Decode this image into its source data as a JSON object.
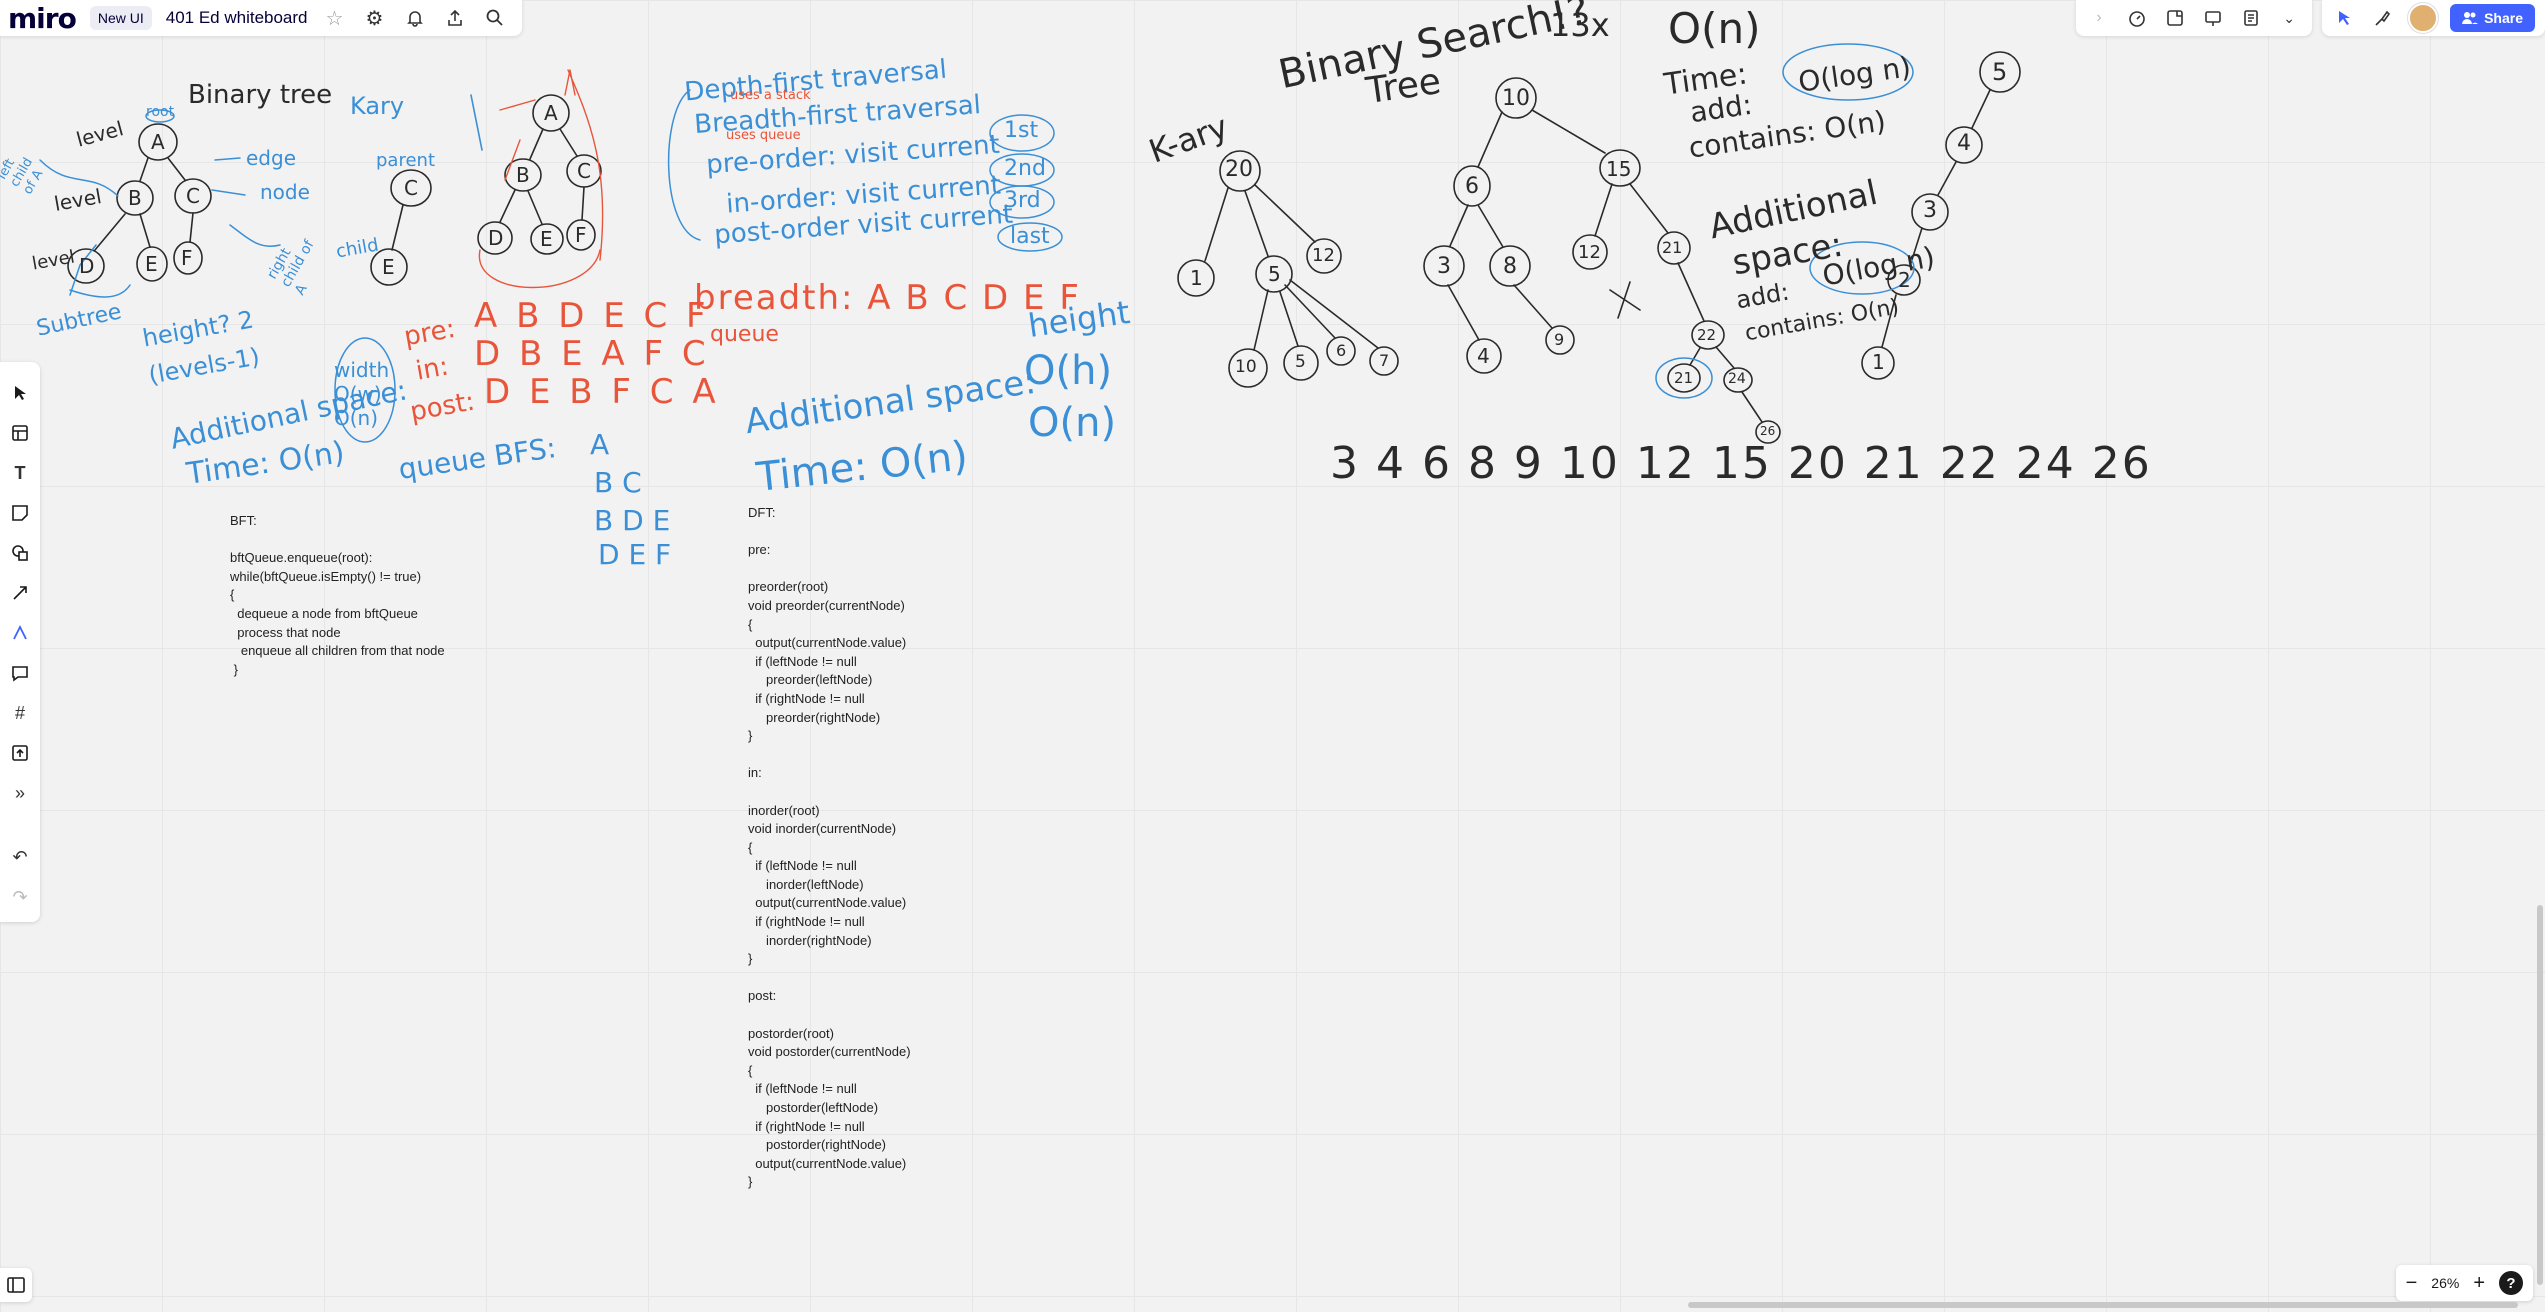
{
  "app": {
    "logo": "miro",
    "new_ui_badge": "New UI",
    "board_title": "401 Ed whiteboard",
    "share_label": "Share",
    "zoom_level": "26%",
    "help_label": "?"
  },
  "icons": {
    "star": "star-icon",
    "settings": "gear-icon",
    "notifications": "bell-icon",
    "export": "upload-icon",
    "search": "search-icon"
  },
  "colors": {
    "accent": "#4262ff",
    "ink_blue": "#3a8fd6",
    "ink_red": "#e8553a",
    "ink_black": "#222222"
  },
  "bft_code": "BFT:\n\nbftQueue.enqueue(root):\nwhile(bftQueue.isEmpty() != true)\n{\n  dequeue a node from bftQueue\n  process that node\n   enqueue all children from that node\n }",
  "dft_code": "DFT:\n\npre:\n\npreorder(root)\nvoid preorder(currentNode)\n{\n  output(currentNode.value)\n  if (leftNode != null\n     preorder(leftNode)\n  if (rightNode != null\n     preorder(rightNode)\n}\n\nin:\n\ninorder(root)\nvoid inorder(currentNode)\n{\n  if (leftNode != null\n     inorder(leftNode)\n  output(currentNode.value)\n  if (rightNode != null\n     inorder(rightNode)\n}\n\npost:\n\npostorder(root)\nvoid postorder(currentNode)\n{\n  if (leftNode != null\n     postorder(leftNode)\n  if (rightNode != null\n     postorder(rightNode)\n  output(currentNode.value)\n}",
  "sketch1": {
    "title": "Binary tree",
    "root_label": "root",
    "level1": "level",
    "level2": "level",
    "level3": "level",
    "edge": "edge",
    "node": "node",
    "left_child": "left child of A",
    "right_child": "right child of A",
    "subtree": "Subtree",
    "height": "height? 2",
    "levels": "(levels-1)",
    "width": "width O(w) O(n)",
    "add_space": "Additional space:",
    "time": "Time: O(n)",
    "nodes": [
      "A",
      "B",
      "C",
      "D",
      "E",
      "F"
    ]
  },
  "sketch2": {
    "kary": "Kary",
    "parent": "parent",
    "child": "child",
    "nodes": [
      "C",
      "E"
    ]
  },
  "sketch3": {
    "pre_label": "pre:",
    "pre_seq": "A B D E C F",
    "in_label": "in:",
    "in_seq": "D B E A F C",
    "post_label": "post:",
    "post_seq": "D E B F C A",
    "queue_bfs": "queue BFS:",
    "queue1": "A",
    "queue2": "B C",
    "queue3": "B D E",
    "queue4": "D E F",
    "nodes": [
      "A",
      "B",
      "C",
      "D",
      "E",
      "F"
    ]
  },
  "sketch4": {
    "dft": "Depth-first traversal",
    "uses_stack": "uses a stack",
    "bft": "Breadth-first traversal",
    "uses_queue": "uses queue",
    "preorder": "pre-order: visit current",
    "inorder": "in-order: visit current",
    "postorder": "post-order visit current",
    "first": "1st",
    "second": "2nd",
    "third": "3rd",
    "last": "last",
    "breadth": "breadth: A B C D E F",
    "queue": "queue",
    "height": "height",
    "o_h": "O(h)",
    "o_n": "O(n)",
    "add_space": "Additional space:",
    "time": "Time: O(n)"
  },
  "sketch5": {
    "kary": "K-ary",
    "nodes": [
      "20",
      "1",
      "5",
      "12",
      "10",
      "5",
      "6",
      "7"
    ]
  },
  "sketch6": {
    "title1": "Binary Search!?",
    "title2": "Tree",
    "x13": "13x",
    "nodes": [
      "10",
      "6",
      "15",
      "3",
      "8",
      "12",
      "21",
      "4",
      "9",
      "22",
      "21",
      "24",
      "26"
    ],
    "sorted": "3 4 6 8 9 10 12 15 20 21 22 24 26"
  },
  "sketch7": {
    "o_n": "O(n)",
    "time": "Time:",
    "add": "add:",
    "o_log_n": "O(log n)",
    "contains": "contains: O(n)",
    "add_space1": "Additional",
    "add_space2": "space:",
    "add2": "add:",
    "o_log_n2": "O(log n)",
    "contains2": "contains: O(n)",
    "chain": [
      "5",
      "4",
      "3",
      "2",
      "1"
    ]
  }
}
